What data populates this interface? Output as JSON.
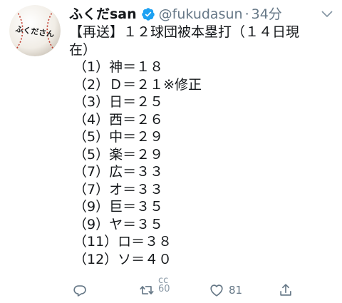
{
  "user": {
    "display_name": "ふくだsan",
    "handle": "@fukudasun",
    "separator": "·",
    "time": "34分",
    "avatar_icon": "baseball-avatar",
    "avatar_text": "ふくださん"
  },
  "tweet": {
    "lines": [
      "【再送】１２球団被本塁打（１４日現",
      "在）",
      "（1）神＝１８",
      "（2）Ｄ＝２１※修正",
      "（3）日＝２５",
      "（4）西＝２６",
      "（5）中＝２９",
      "（5）楽＝２９",
      "（7）広＝３３",
      "（7）オ＝３３",
      "（9）巨＝３５",
      "（9）ヤ＝３５",
      "（11）ロ＝３８",
      "（12）ソ＝４０"
    ]
  },
  "actions": {
    "reply_icon": "reply-icon",
    "retweet_icon": "retweet-icon",
    "retweet_count_top": "ᴄᴄ",
    "retweet_count_bottom": "60",
    "like_icon": "heart-icon",
    "like_count": "81",
    "share_icon": "share-icon"
  },
  "colors": {
    "text": "#14171a",
    "secondary": "#657786",
    "verified": "#1da1f2",
    "stitch": "#c0392b"
  }
}
